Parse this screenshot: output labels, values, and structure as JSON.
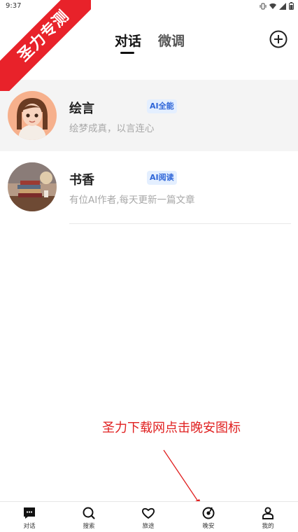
{
  "status_bar": {
    "time": "9:37"
  },
  "ribbon": {
    "text": "圣力专测"
  },
  "header": {
    "tabs": [
      {
        "label": "对话"
      },
      {
        "label": "微调"
      }
    ]
  },
  "chats": [
    {
      "name": "绘言",
      "badge": "AI全能",
      "desc": "绘梦成真，以言连心"
    },
    {
      "name": "书香",
      "badge": "AI阅读",
      "desc": "有位AI作者,每天更新一篇文章"
    }
  ],
  "annotation": {
    "text": "圣力下载网点击晚安图标"
  },
  "bottom_nav": [
    {
      "label": "对话"
    },
    {
      "label": "搜索"
    },
    {
      "label": "旅途"
    },
    {
      "label": "晚安"
    },
    {
      "label": "我的"
    }
  ],
  "colors": {
    "ribbon": "#e8222a",
    "badge_bg": "#e4efff",
    "badge_text": "#2f66d8",
    "annotation": "#e02020"
  }
}
